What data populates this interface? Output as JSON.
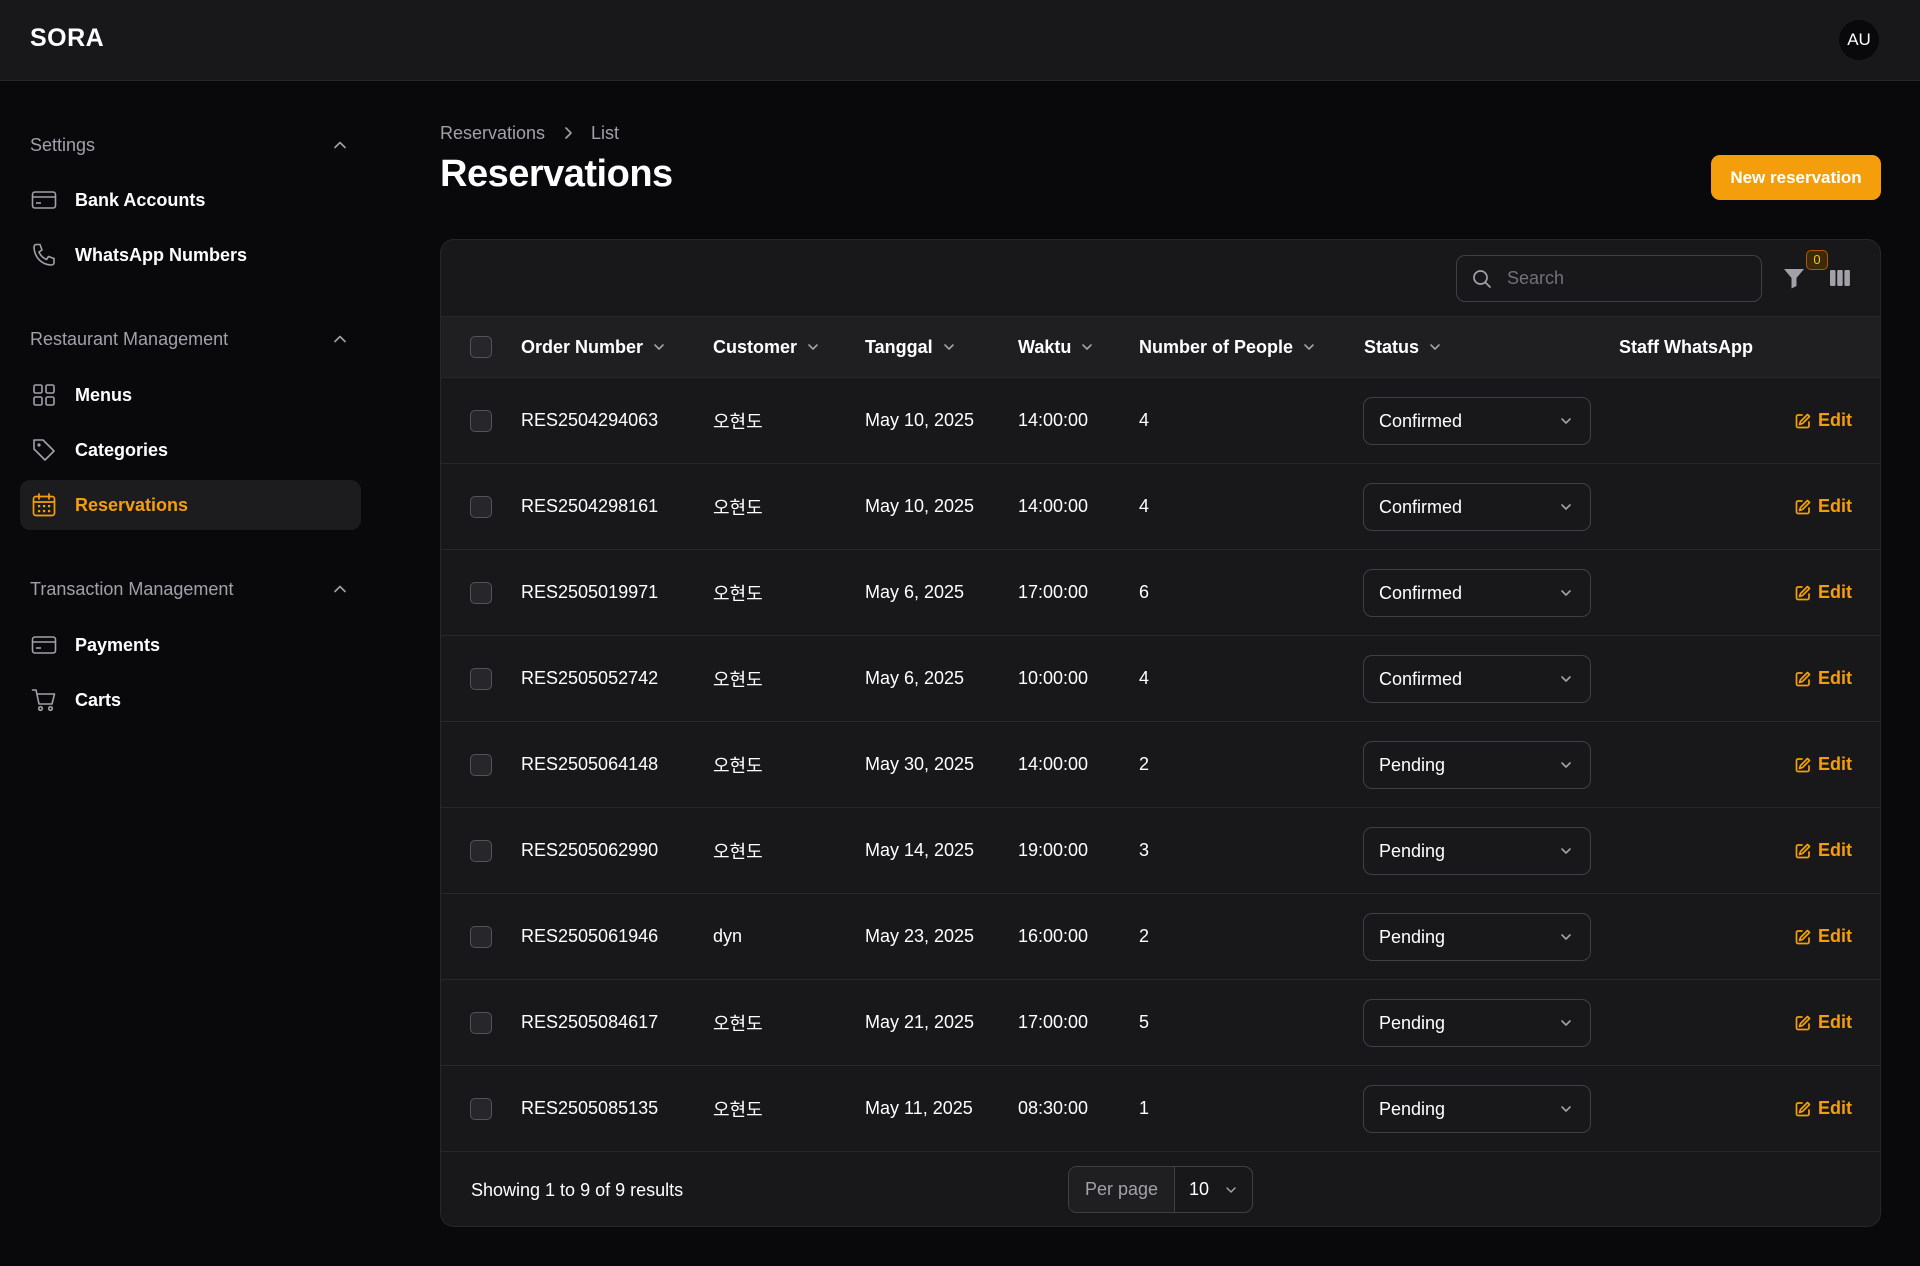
{
  "app": {
    "brand": "SORA",
    "avatar_initials": "AU"
  },
  "colors": {
    "accent": "#f59e0b",
    "background": "#09090b",
    "surface": "#18181b"
  },
  "sidebar": {
    "groups": [
      {
        "label": "Settings",
        "items": [
          {
            "label": "Bank Accounts",
            "icon": "credit-card-icon"
          },
          {
            "label": "WhatsApp Numbers",
            "icon": "phone-icon"
          }
        ]
      },
      {
        "label": "Restaurant Management",
        "items": [
          {
            "label": "Menus",
            "icon": "grid-icon"
          },
          {
            "label": "Categories",
            "icon": "tag-icon"
          },
          {
            "label": "Reservations",
            "icon": "calendar-icon",
            "active": true
          }
        ]
      },
      {
        "label": "Transaction Management",
        "items": [
          {
            "label": "Payments",
            "icon": "credit-card-icon"
          },
          {
            "label": "Carts",
            "icon": "cart-icon"
          }
        ]
      }
    ]
  },
  "header": {
    "breadcrumb": [
      "Reservations",
      "List"
    ],
    "title": "Reservations",
    "new_button": "New reservation"
  },
  "toolbar": {
    "search_placeholder": "Search",
    "filter_count": "0"
  },
  "table": {
    "columns": [
      "Order Number",
      "Customer",
      "Tanggal",
      "Waktu",
      "Number of People",
      "Status",
      "Staff WhatsApp"
    ],
    "edit_label": "Edit",
    "rows": [
      {
        "order": "RES2504294063",
        "customer": "오현도",
        "date": "May 10, 2025",
        "time": "14:00:00",
        "people": "4",
        "status": "Confirmed"
      },
      {
        "order": "RES2504298161",
        "customer": "오현도",
        "date": "May 10, 2025",
        "time": "14:00:00",
        "people": "4",
        "status": "Confirmed"
      },
      {
        "order": "RES2505019971",
        "customer": "오현도",
        "date": "May 6, 2025",
        "time": "17:00:00",
        "people": "6",
        "status": "Confirmed"
      },
      {
        "order": "RES2505052742",
        "customer": "오현도",
        "date": "May 6, 2025",
        "time": "10:00:00",
        "people": "4",
        "status": "Confirmed"
      },
      {
        "order": "RES2505064148",
        "customer": "오현도",
        "date": "May 30, 2025",
        "time": "14:00:00",
        "people": "2",
        "status": "Pending"
      },
      {
        "order": "RES2505062990",
        "customer": "오현도",
        "date": "May 14, 2025",
        "time": "19:00:00",
        "people": "3",
        "status": "Pending"
      },
      {
        "order": "RES2505061946",
        "customer": "dyn",
        "date": "May 23, 2025",
        "time": "16:00:00",
        "people": "2",
        "status": "Pending"
      },
      {
        "order": "RES2505084617",
        "customer": "오현도",
        "date": "May 21, 2025",
        "time": "17:00:00",
        "people": "5",
        "status": "Pending"
      },
      {
        "order": "RES2505085135",
        "customer": "오현도",
        "date": "May 11, 2025",
        "time": "08:30:00",
        "people": "1",
        "status": "Pending"
      }
    ]
  },
  "pagination": {
    "results_text": "Showing 1 to 9 of 9 results",
    "per_page_label": "Per page",
    "per_page_value": "10"
  }
}
